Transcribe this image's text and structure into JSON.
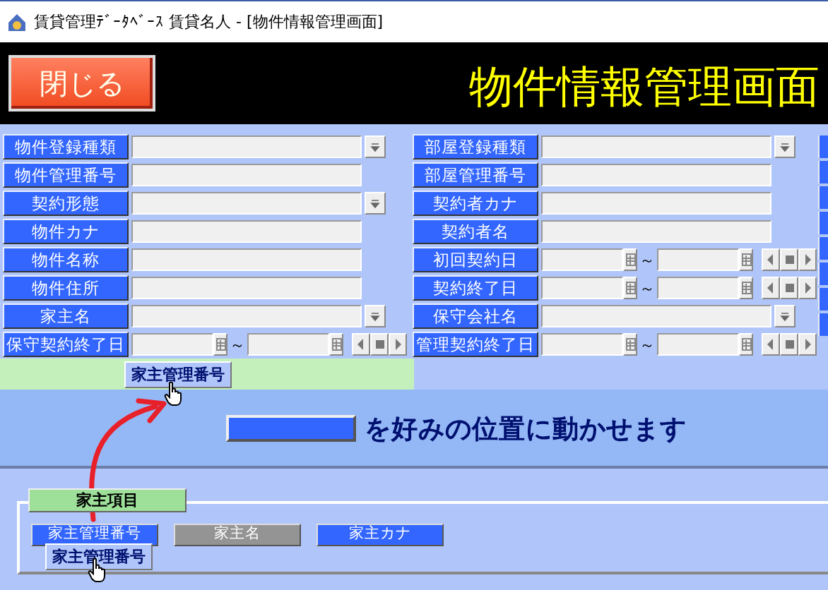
{
  "window": {
    "title": "賃貸管理ﾃﾞｰﾀﾍﾞｰｽ 賃貸名人 - [物件情報管理画面]"
  },
  "header": {
    "close_button": "閉じる",
    "title": "物件情報管理画面"
  },
  "form_columns": [
    [
      {
        "label": "物件登録種類",
        "kind": "combo"
      },
      {
        "label": "物件管理番号",
        "kind": "text"
      },
      {
        "label": "契約形態",
        "kind": "combo"
      },
      {
        "label": "物件カナ",
        "kind": "text"
      },
      {
        "label": "物件名称",
        "kind": "text"
      },
      {
        "label": "物件住所",
        "kind": "text"
      },
      {
        "label": "家主名",
        "kind": "combo"
      },
      {
        "label": "保守契約終了日",
        "kind": "daterange",
        "separator": "～"
      }
    ],
    [
      {
        "label": "部屋登録種類",
        "kind": "combo"
      },
      {
        "label": "部屋管理番号",
        "kind": "text"
      },
      {
        "label": "契約者カナ",
        "kind": "text"
      },
      {
        "label": "契約者名",
        "kind": "text"
      },
      {
        "label": "初回契約日",
        "kind": "daterange",
        "separator": "～"
      },
      {
        "label": "契約終了日",
        "kind": "daterange",
        "separator": "～"
      },
      {
        "label": "保守会社名",
        "kind": "combo"
      },
      {
        "label": "管理契約終了日",
        "kind": "daterange",
        "separator": "～"
      }
    ]
  ],
  "placed_item": "家主管理番号",
  "hint": {
    "text": "を好みの位置に動かせます"
  },
  "item_group": {
    "legend": "家主項目",
    "items": [
      {
        "label": "家主管理番号",
        "disabled": false
      },
      {
        "label": "家主名",
        "disabled": true
      },
      {
        "label": "家主カナ",
        "disabled": false
      }
    ]
  },
  "dragged_item": "家主管理番号"
}
